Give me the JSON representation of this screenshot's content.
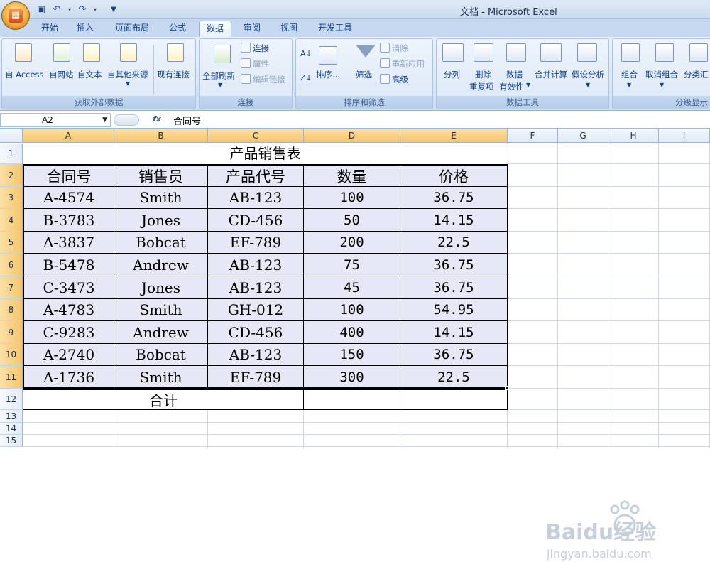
{
  "window": {
    "title": "文档 - Microsoft Excel"
  },
  "tabs": [
    "开始",
    "插入",
    "页面布局",
    "公式",
    "数据",
    "审阅",
    "视图",
    "开发工具"
  ],
  "active_tab": "数据",
  "ribbon": {
    "get_external": {
      "label": "获取外部数据",
      "buttons": [
        "自 Access",
        "自网站",
        "自文本",
        "自其他来源",
        "现有连接"
      ]
    },
    "connections": {
      "label": "连接",
      "refresh_all": "全部刷新",
      "small": [
        "连接",
        "属性",
        "编辑链接"
      ]
    },
    "sort_filter": {
      "label": "排序和筛选",
      "sort": "排序...",
      "filter": "筛选",
      "small": [
        "清除",
        "重新应用",
        "高级"
      ]
    },
    "data_tools": {
      "label": "数据工具",
      "split": "分列",
      "remove_dup_1": "删除",
      "remove_dup_2": "重复项",
      "validity_1": "数据",
      "validity_2": "有效性",
      "merge": "合并计算",
      "whatif": "假设分析"
    },
    "outline": {
      "label": "分级显示",
      "group": "组合",
      "ungroup": "取消组合",
      "subtotal": "分类汇"
    }
  },
  "formula_bar": {
    "name_box": "A2",
    "fx": "fx",
    "content": "合同号"
  },
  "columns": [
    "A",
    "B",
    "C",
    "D",
    "E",
    "F",
    "G",
    "H",
    "I"
  ],
  "rows": [
    "1",
    "2",
    "3",
    "4",
    "5",
    "6",
    "7",
    "8",
    "9",
    "10",
    "11",
    "12",
    "13",
    "14",
    "15"
  ],
  "sheet": {
    "title": "产品销售表",
    "headers": [
      "合同号",
      "销售员",
      "产品代号",
      "数量",
      "价格"
    ],
    "records": [
      [
        "A-4574",
        "Smith",
        "AB-123",
        "100",
        "36.75"
      ],
      [
        "B-3783",
        "Jones",
        "CD-456",
        "50",
        "14.15"
      ],
      [
        "A-3837",
        "Bobcat",
        "EF-789",
        "200",
        "22.5"
      ],
      [
        "B-5478",
        "Andrew",
        "AB-123",
        "75",
        "36.75"
      ],
      [
        "C-3473",
        "Jones",
        "AB-123",
        "45",
        "36.75"
      ],
      [
        "A-4783",
        "Smith",
        "GH-012",
        "100",
        "54.95"
      ],
      [
        "C-9283",
        "Andrew",
        "CD-456",
        "400",
        "14.15"
      ],
      [
        "A-2740",
        "Bobcat",
        "AB-123",
        "150",
        "36.75"
      ],
      [
        "A-1736",
        "Smith",
        "EF-789",
        "300",
        "22.5"
      ]
    ],
    "total_label": "合计"
  },
  "watermark": {
    "text": "Baidu经验",
    "url": "jingyan.baidu.com"
  },
  "colors": {
    "selected_fill": "#e6e9f5",
    "ribbon_bg": "#dbe7f6",
    "header_sel": "#f5c56b"
  }
}
